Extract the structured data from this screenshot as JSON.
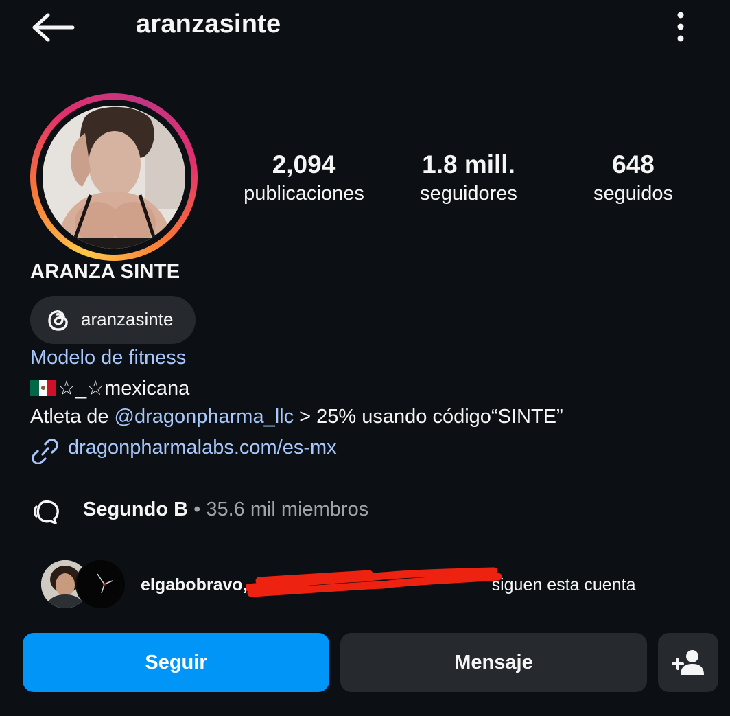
{
  "header": {
    "username": "aranzasinte",
    "back_icon": "arrow-left-icon",
    "menu_icon": "more-vertical-icon"
  },
  "profile": {
    "full_name": "ARANZA SINTE",
    "threads_handle": "aranzasinte",
    "category": "Modelo de fitness",
    "bio_line1_text": "☆_☆mexicana",
    "bio_line2_prefix": "Atleta de ",
    "bio_line2_mention": "@dragonpharma_llc",
    "bio_line2_suffix": " > 25% usando código“SINTE”",
    "link": "dragonpharmalabs.com/es-mx"
  },
  "stats": [
    {
      "value": "2,094",
      "label": "publicaciones"
    },
    {
      "value": "1.8 mill.",
      "label": "seguidores"
    },
    {
      "value": "648",
      "label": "seguidos"
    }
  ],
  "channel": {
    "name": "Segundo B",
    "meta": " • 35.6 mil miembros"
  },
  "followed_by": {
    "first": "elgabobravo,",
    "rest": "siguen esta cuenta"
  },
  "actions": {
    "follow": "Seguir",
    "message": "Mensaje"
  },
  "colors": {
    "background": "#0c1014",
    "accent_blue": "#0095f6",
    "link_blue": "#a8c7fa",
    "button_gray": "#26292e",
    "scribble_red": "#ee2211"
  }
}
